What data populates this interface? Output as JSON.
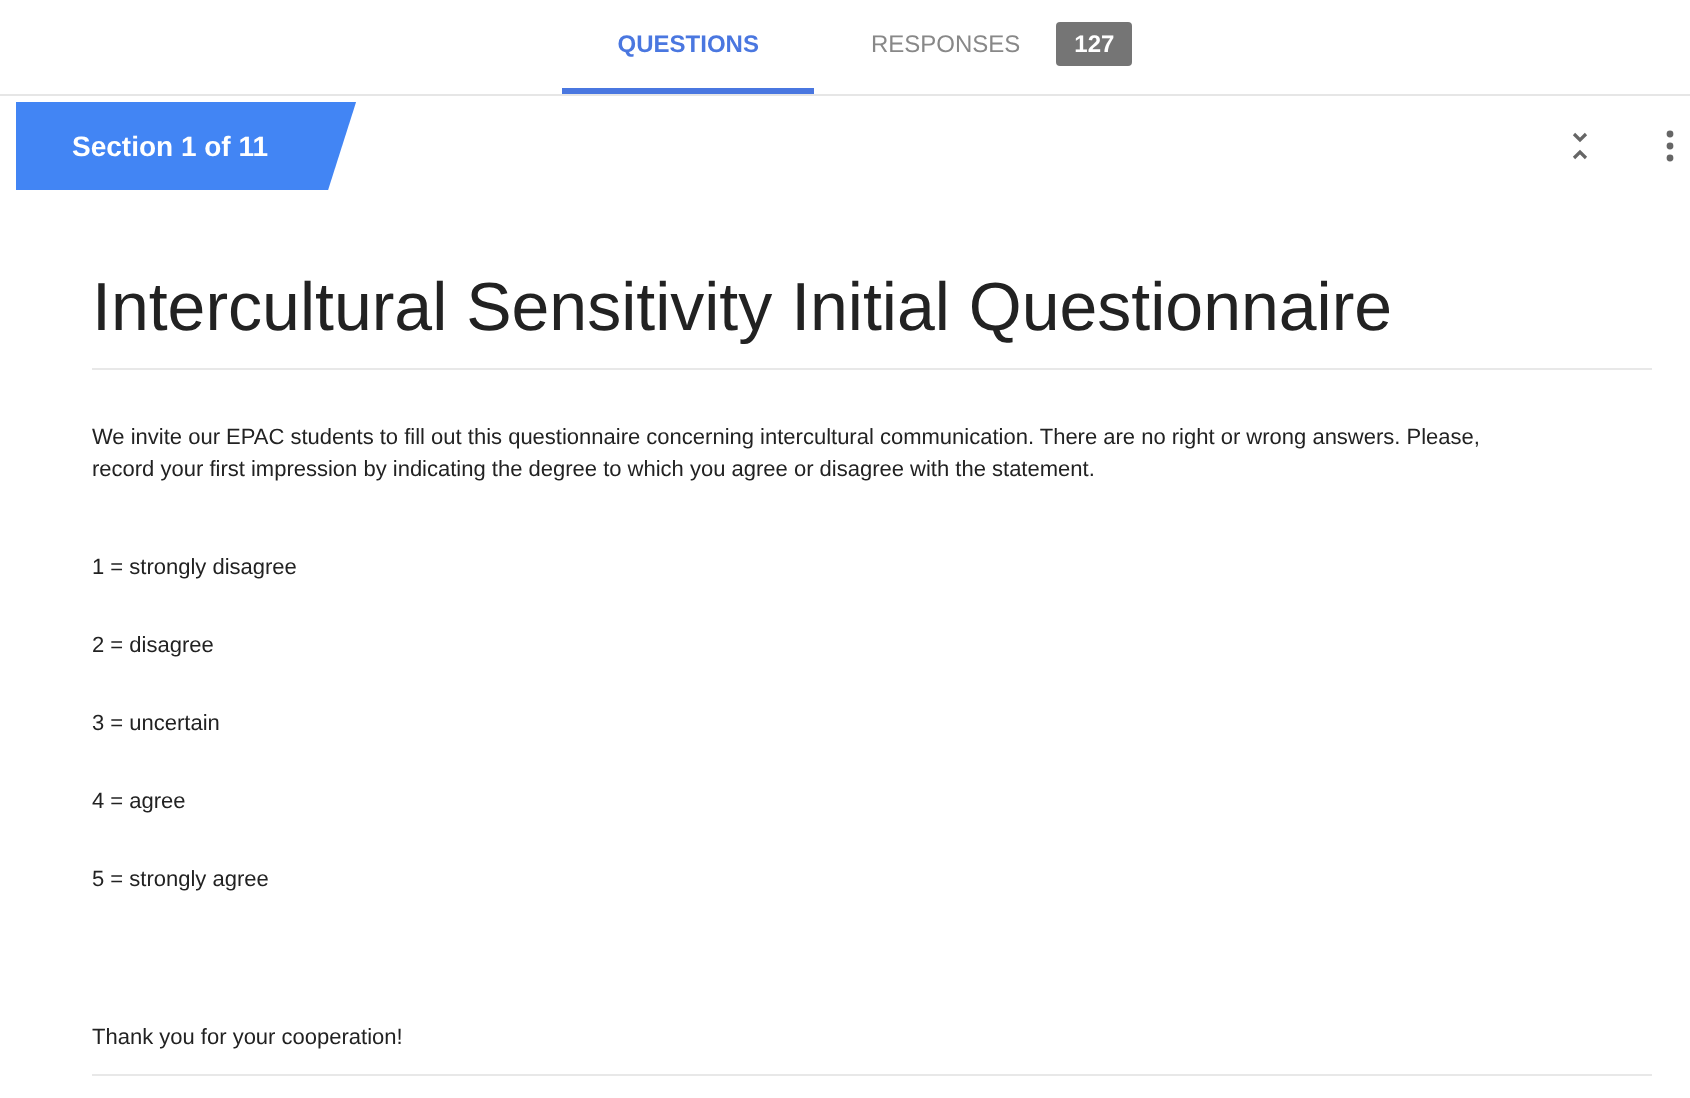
{
  "tabs": [
    {
      "label": "QUESTIONS",
      "selected": true
    },
    {
      "label": "RESPONSES",
      "selected": false,
      "badge": "127"
    }
  ],
  "section": {
    "label": "Section 1 of 11"
  },
  "form": {
    "title": "Intercultural Sensitivity Initial Questionnaire",
    "paragraphs": [
      "We invite our EPAC students to fill out this questionnaire concerning intercultural communication. There are no right or wrong answers. Please, record your first impression by indicating the degree to which you agree or disagree with the statement.",
      "1 = strongly disagree",
      "2 = disagree",
      "3 = uncertain",
      "4 = agree",
      "5 = strongly agree",
      "Thank you for your cooperation!"
    ]
  }
}
